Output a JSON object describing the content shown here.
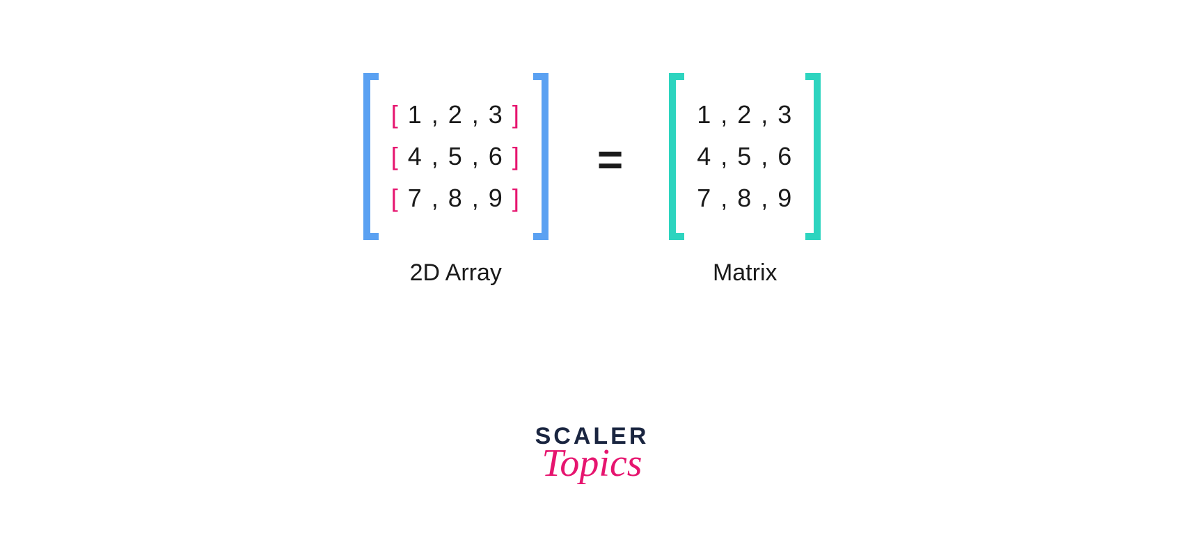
{
  "colors": {
    "outer_bracket_left": "#5aa1f2",
    "inner_bracket": "#e6156f",
    "outer_bracket_right": "#2dd4bf",
    "text": "#1a1a1a",
    "logo_main": "#1a2540",
    "logo_sub": "#e6156f"
  },
  "array2d": {
    "label": "2D Array",
    "rows": [
      {
        "open": "[",
        "content": " 1 , 2 , 3 ",
        "close": "]"
      },
      {
        "open": "[",
        "content": " 4 , 5 , 6 ",
        "close": "]"
      },
      {
        "open": "[",
        "content": " 7 , 8 , 9 ",
        "close": "]"
      }
    ]
  },
  "equals": "=",
  "matrix": {
    "label": "Matrix",
    "rows": [
      "1 , 2 , 3",
      "4 , 5 , 6",
      "7 , 8 , 9"
    ]
  },
  "logo": {
    "main": "SCALER",
    "sub": "Topics"
  }
}
